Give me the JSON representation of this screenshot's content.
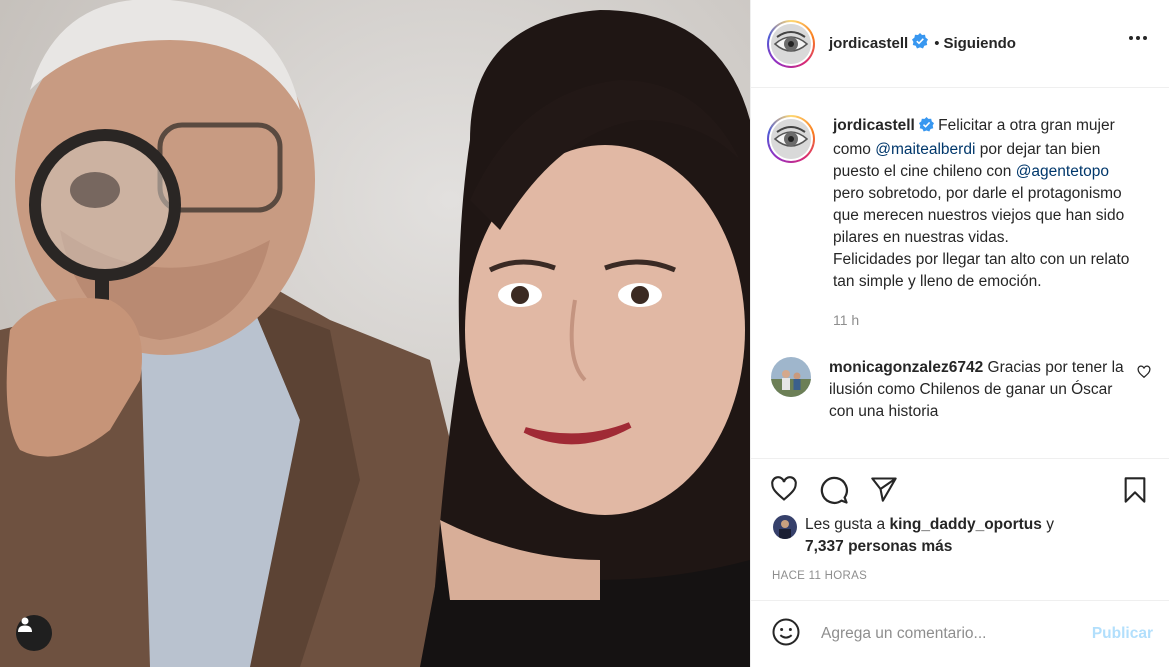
{
  "post": {
    "author": "jordicastell",
    "separator": "•",
    "follow_status": "Siguiendo"
  },
  "caption": {
    "username": "jordicastell",
    "text_1": "Felicitar a otra gran mujer como ",
    "mention_1": "@maitealberdi",
    "text_2": " por dejar tan bien puesto el cine chileno con ",
    "mention_2": "@agentetopo",
    "text_3": " pero sobretodo, por darle el protagonismo que merecen nuestros viejos que han sido pilares en nuestras vidas.",
    "text_4": "Felicidades por llegar tan alto con un relato tan simple y lleno de emoción.",
    "time": "11 h"
  },
  "comment": {
    "username": "monicagonzalez6742",
    "text": "Gracias por tener la ilusión como Chilenos de ganar un Óscar con una historia"
  },
  "likes": {
    "prefix": "Les gusta a ",
    "user": "king_daddy_oportus",
    "middle": " y ",
    "count": "7,337 personas más"
  },
  "timestamp": "HACE 11 HORAS",
  "add_comment": {
    "placeholder": "Agrega un comentario...",
    "publish_label": "Publicar"
  },
  "icons": {
    "like": "heart-icon",
    "comment": "comment-icon",
    "share": "share-icon",
    "save": "bookmark-icon",
    "emoji": "emoji-icon",
    "more": "more-options-icon",
    "tag": "user-tag-icon"
  },
  "colors": {
    "link": "#00376b",
    "muted": "#8e8e8e",
    "publish_disabled": "#b2dffc",
    "verified": "#3897f0"
  }
}
